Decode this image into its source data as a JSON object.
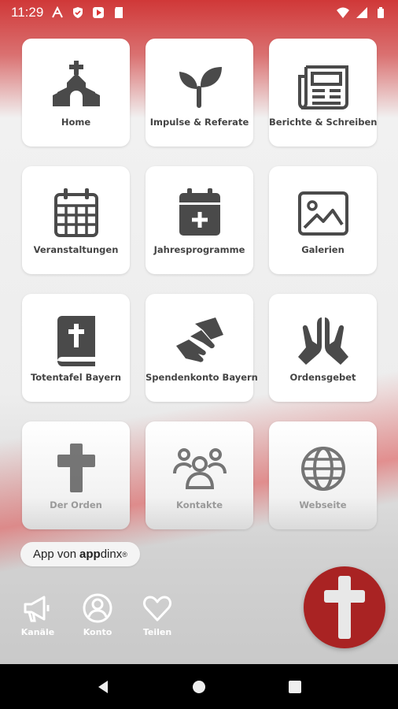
{
  "status": {
    "time": "11:29",
    "icons": [
      "font-icon",
      "shield-icon",
      "play-protect-icon",
      "sd-card-icon",
      "wifi-icon",
      "signal-icon",
      "battery-icon"
    ]
  },
  "tiles": [
    {
      "label": "Home",
      "icon": "church-icon"
    },
    {
      "label": "Impulse & Referate",
      "icon": "sprout-icon"
    },
    {
      "label": "Berichte & Schreiben",
      "icon": "newspaper-icon"
    },
    {
      "label": "Veranstaltungen",
      "icon": "calendar-icon"
    },
    {
      "label": "Jahresprogramme",
      "icon": "calendar-plus-icon"
    },
    {
      "label": "Galerien",
      "icon": "image-icon"
    },
    {
      "label": "Totentafel Bayern",
      "icon": "bible-icon"
    },
    {
      "label": "Spendenkonto Bayern",
      "icon": "handshake-icon"
    },
    {
      "label": "Ordensgebet",
      "icon": "praying-hands-icon"
    },
    {
      "label": "Der Orden",
      "icon": "cross-icon"
    },
    {
      "label": "Kontakte",
      "icon": "users-icon"
    },
    {
      "label": "Webseite",
      "icon": "globe-icon"
    }
  ],
  "appdinx": {
    "prefix": "App von",
    "brand_bold": "app",
    "brand_rest": "dinx",
    "mark": "®"
  },
  "actions": [
    {
      "label": "Kanäle",
      "icon": "megaphone-icon"
    },
    {
      "label": "Konto",
      "icon": "account-icon"
    },
    {
      "label": "Teilen",
      "icon": "heart-icon"
    }
  ],
  "fab": {
    "icon": "cross-icon",
    "color": "#a92323"
  },
  "colors": {
    "accent": "#d32f2f",
    "icon_gray": "#4a4a4a"
  }
}
